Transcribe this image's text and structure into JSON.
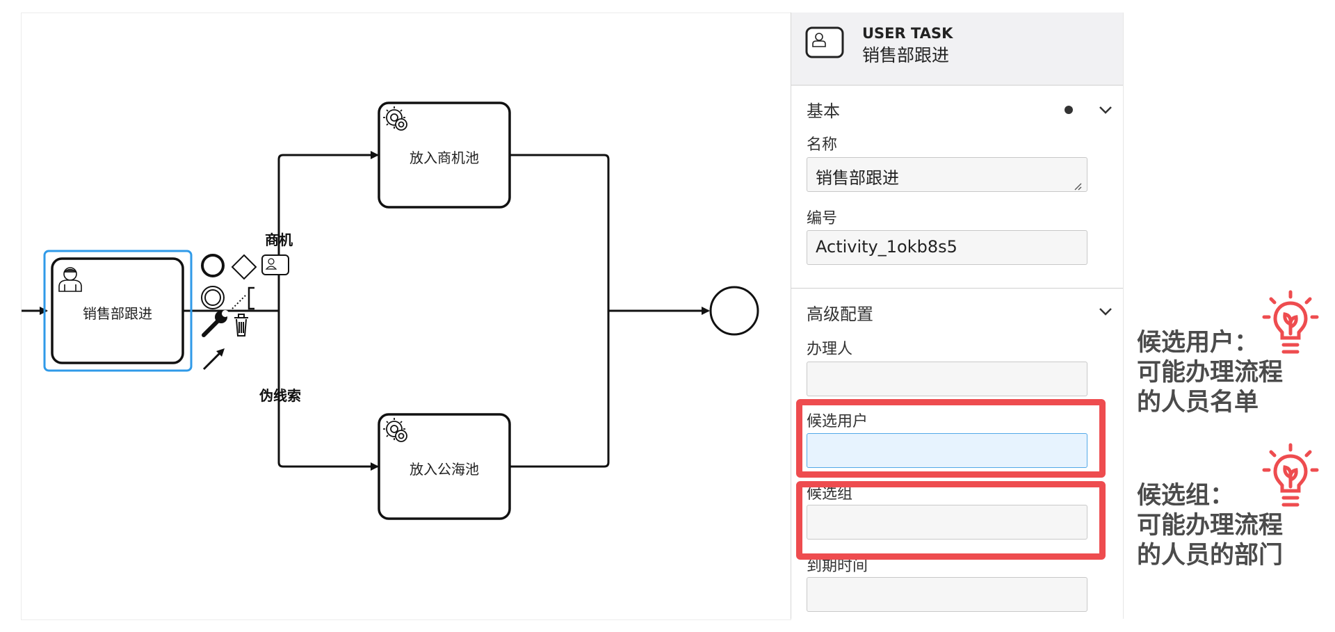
{
  "diagram": {
    "task_user": "销售部跟进",
    "task_top": "放入商机池",
    "task_bottom": "放入公海池",
    "flow_top": "商机",
    "flow_bottom": "伪线索"
  },
  "panel": {
    "type_label": "USER TASK",
    "element_name": "销售部跟进",
    "group_basic": {
      "title": "基本",
      "name_label": "名称",
      "name_value": "销售部跟进",
      "id_label": "编号",
      "id_value": "Activity_1okb8s5"
    },
    "group_advanced": {
      "title": "高级配置",
      "assignee_label": "办理人",
      "assignee_value": "",
      "candidate_users_label": "候选用户",
      "candidate_users_value": "",
      "candidate_groups_label": "候选组",
      "candidate_groups_value": "",
      "due_date_label": "到期时间",
      "due_date_value": ""
    }
  },
  "annotations": {
    "users_note": [
      "候选用户：",
      "可能办理流程",
      "的人员名单"
    ],
    "groups_note": [
      "候选组：",
      "可能办理流程",
      "的人员的部门"
    ]
  },
  "icons": [
    "user-task-icon",
    "service-task-gear-icon",
    "end-event-icon",
    "start-event-icon",
    "gateway-icon",
    "intermediate-event-icon",
    "text-annotation-icon",
    "wrench-icon",
    "trash-icon",
    "arrow-connect-icon",
    "chevron-down-icon",
    "bulb-icon"
  ],
  "colors": {
    "selection": "#2f9ae8",
    "highlight": "#ee4c4f",
    "focused_input": "#e7f3fe"
  }
}
